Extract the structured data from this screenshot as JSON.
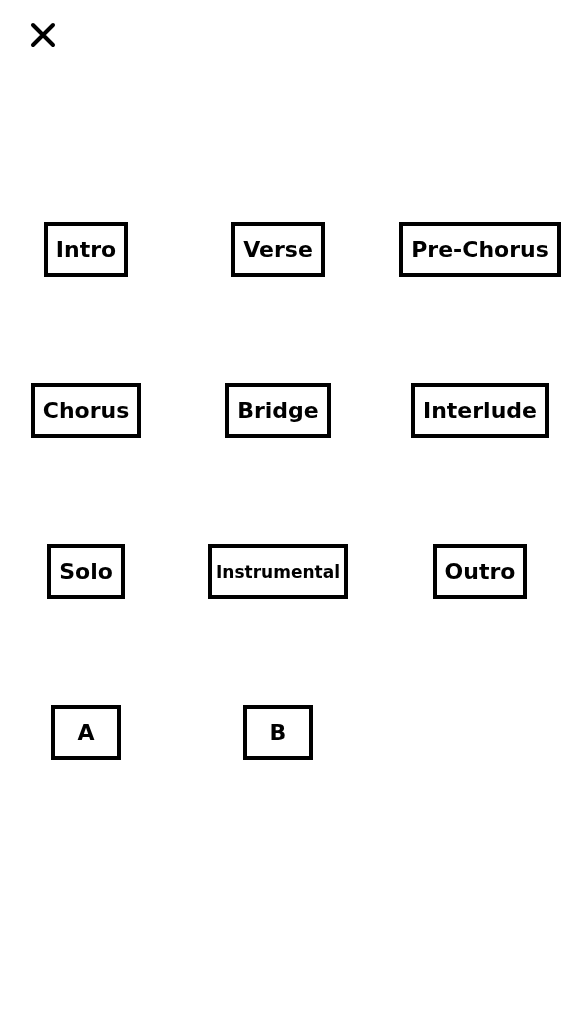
{
  "sections": [
    "Intro",
    "Verse",
    "Pre-Chorus",
    "Chorus",
    "Bridge",
    "Interlude",
    "Solo",
    "Instrumental",
    "Outro",
    "A",
    "B"
  ]
}
